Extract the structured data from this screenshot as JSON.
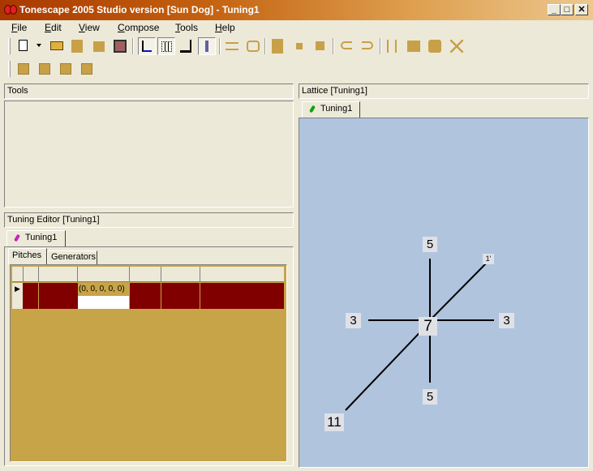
{
  "window": {
    "title": "Tonescape 2005 Studio  version [Sun Dog]  -  Tuning1",
    "min_symbol": "_",
    "max_symbol": "□",
    "close_symbol": "✕"
  },
  "menu": [
    "File",
    "Edit",
    "View",
    "Compose",
    "Tools",
    "Help"
  ],
  "menu_underline": [
    "F",
    "E",
    "V",
    "C",
    "T",
    "H"
  ],
  "panes": {
    "tools": {
      "title": "Tools"
    },
    "tuning_editor": {
      "title": "Tuning Editor  [Tuning1]",
      "doc_tab": "Tuning1",
      "subtabs": [
        "Pitches",
        "Generators"
      ],
      "grid": {
        "rows": [
          {
            "indicator": "▶",
            "vector": "(0, 0, 0, 0, 0)"
          }
        ]
      }
    },
    "lattice": {
      "title": "Lattice  [Tuning1]",
      "doc_tab": "Tuning1",
      "center_label": "7",
      "labels": {
        "up": "5",
        "down": "5",
        "left": "3",
        "right": "3",
        "upper_right": "1'",
        "lower_left": "11"
      }
    }
  },
  "colors": {
    "window_bg": "#ece9d8",
    "title_grad_start": "#a83800",
    "lattice_bg": "#b0c4de",
    "grid_bg": "#c8a448",
    "grid_row": "#800000"
  }
}
